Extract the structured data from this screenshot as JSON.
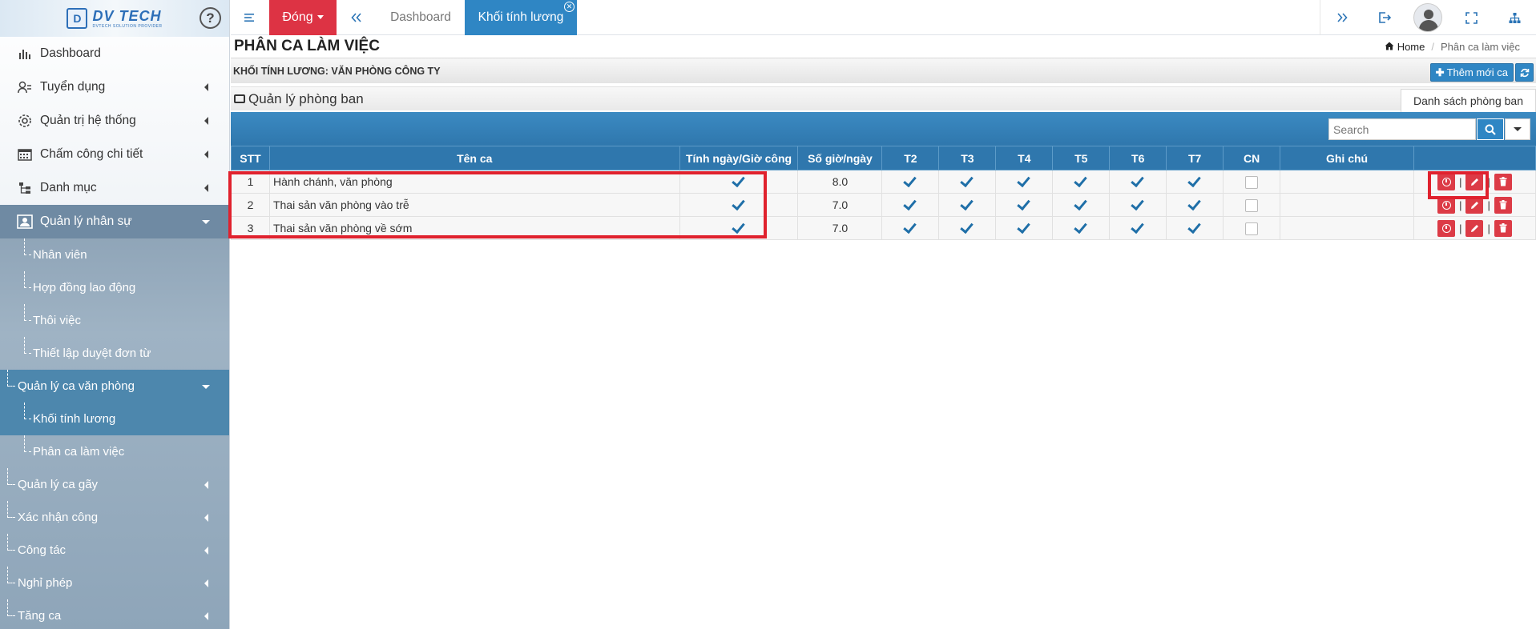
{
  "sidebar": {
    "logo_name": "DV TECH",
    "logo_sub": "DVTECH SOLUTION PROVIDER",
    "help": "?",
    "items": [
      {
        "label": "Dashboard"
      },
      {
        "label": "Tuyển dụng"
      },
      {
        "label": "Quản trị hệ thống"
      },
      {
        "label": "Chấm công chi tiết"
      },
      {
        "label": "Danh mục"
      },
      {
        "label": "Quản lý nhân sự"
      }
    ],
    "sub_nhansu": [
      "Nhân viên",
      "Hợp đồng lao động",
      "Thôi việc",
      "Thiết lập duyệt đơn từ"
    ],
    "qlca": "Quản lý ca văn phòng",
    "sub_qlca": [
      "Khối tính lương",
      "Phân ca làm việc"
    ],
    "rest": [
      "Quản lý ca gãy",
      "Xác nhận công",
      "Công tác",
      "Nghỉ phép",
      "Tăng ca"
    ]
  },
  "topbar": {
    "dong": "Đóng",
    "tab1": "Dashboard",
    "tab2": "Khối tính lương"
  },
  "page": {
    "title": "PHÂN CA LÀM VIỆC",
    "breadcrumb_home": "Home",
    "breadcrumb_current": "Phân ca làm việc",
    "section_title": "KHỐI TÍNH LƯƠNG: VĂN PHÒNG CÔNG TY",
    "add_label": "Thêm mới ca",
    "panel_title": "Quản lý phòng ban",
    "tab_list": "Danh sách phòng ban",
    "search_placeholder": "Search"
  },
  "table": {
    "headers": [
      "STT",
      "Tên ca",
      "Tính ngày/Giờ công",
      "Số giờ/ngày",
      "T2",
      "T3",
      "T4",
      "T5",
      "T6",
      "T7",
      "CN",
      "Ghi chú",
      ""
    ],
    "rows": [
      {
        "stt": "1",
        "name": "Hành chánh, văn phòng",
        "tinh": true,
        "hours": "8.0",
        "days": [
          true,
          true,
          true,
          true,
          true,
          true,
          false
        ],
        "note": ""
      },
      {
        "stt": "2",
        "name": "Thai sản văn phòng vào trễ",
        "tinh": true,
        "hours": "7.0",
        "days": [
          true,
          true,
          true,
          true,
          true,
          true,
          false
        ],
        "note": ""
      },
      {
        "stt": "3",
        "name": "Thai sản văn phòng về sớm",
        "tinh": true,
        "hours": "7.0",
        "days": [
          true,
          true,
          true,
          true,
          true,
          true,
          false
        ],
        "note": ""
      }
    ]
  },
  "colors": {
    "accent": "#2f86c4",
    "danger": "#dc3b46",
    "header": "#2f77ad",
    "highlight": "#e0222e"
  }
}
